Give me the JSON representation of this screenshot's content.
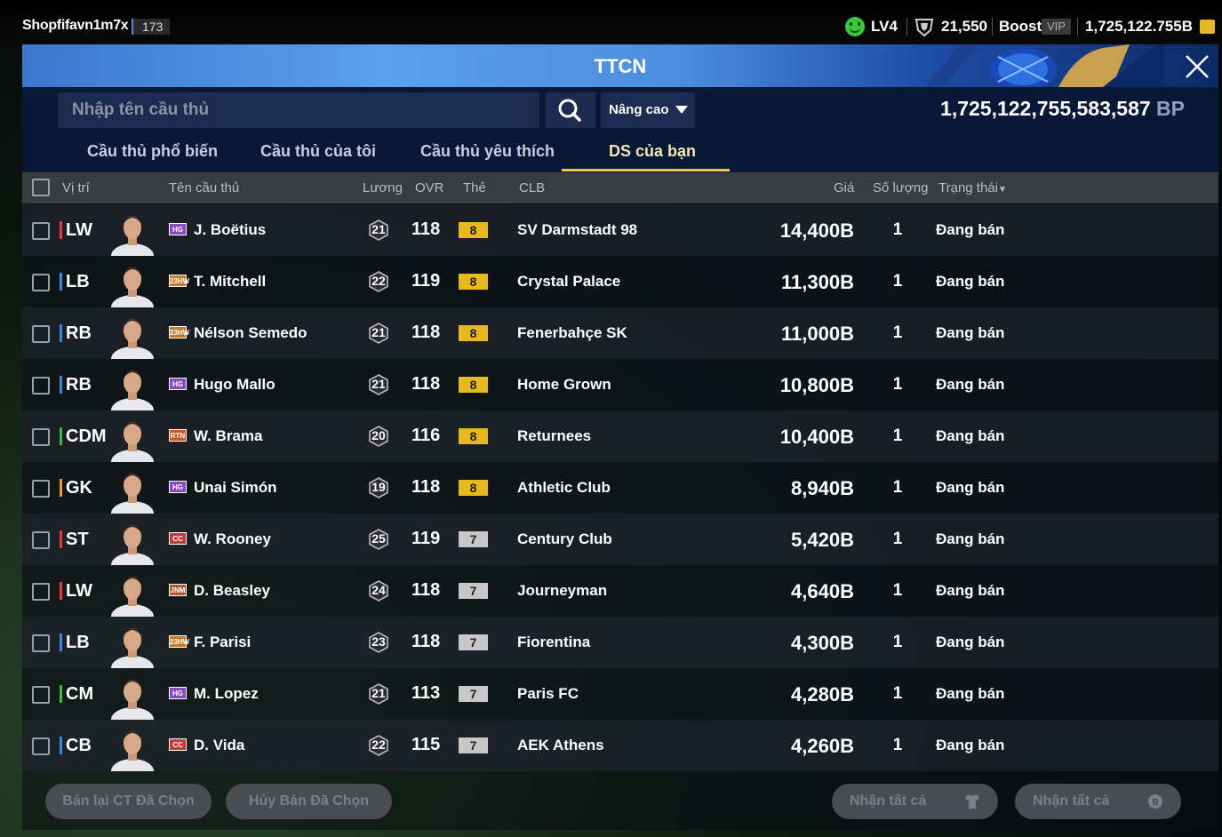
{
  "header": {
    "username": "Shopfifavn1m7x",
    "user_badge": "173",
    "level": "LV4",
    "trophies": "21,550",
    "boost": "Boost",
    "vip": "VIP",
    "coins": "1,725,122.755B"
  },
  "window": {
    "title": "TTCN",
    "search_placeholder": "Nhập tên cầu thủ",
    "advanced_label": "Nâng cao",
    "bp_amount": "1,725,122,755,583,587",
    "bp_unit": "BP"
  },
  "tabs": [
    "Cầu thủ phổ biến",
    "Cầu thủ của tôi",
    "Cầu thủ yêu thích",
    "DS của bạn"
  ],
  "columns": {
    "position": "Vị trí",
    "player": "Tên cầu thủ",
    "wage": "Lương",
    "ovr": "OVR",
    "grade": "Thẻ",
    "club": "CLB",
    "price": "Giá",
    "quantity": "Số lượng",
    "status": "Trạng thái"
  },
  "colors": {
    "forward": "#e8383c",
    "defender": "#3a8ad8",
    "midfielder": "#3ab84a",
    "goalkeeper": "#e8a020",
    "grade8": "#e8b820",
    "grade7": "#c8c8c8"
  },
  "players": [
    {
      "pos": "LW",
      "group": "forward",
      "season": "HG",
      "season_color": "#8a4ac8",
      "name": "J. Boëtius",
      "wage": "21",
      "ovr": "118",
      "grade": "8",
      "club": "SV Darmstadt 98",
      "price": "14,400B",
      "qty": "1",
      "status": "Đang bán"
    },
    {
      "pos": "LB",
      "group": "defender",
      "season": "23HW",
      "season_color": "#c87a28",
      "name": "T. Mitchell",
      "wage": "22",
      "ovr": "119",
      "grade": "8",
      "club": "Crystal Palace",
      "price": "11,300B",
      "qty": "1",
      "status": "Đang bán"
    },
    {
      "pos": "RB",
      "group": "defender",
      "season": "23HW",
      "season_color": "#c87a28",
      "name": "Nélson Semedo",
      "wage": "21",
      "ovr": "118",
      "grade": "8",
      "club": "Fenerbahçe SK",
      "price": "11,000B",
      "qty": "1",
      "status": "Đang bán"
    },
    {
      "pos": "RB",
      "group": "defender",
      "season": "HG",
      "season_color": "#8a4ac8",
      "name": "Hugo Mallo",
      "wage": "21",
      "ovr": "118",
      "grade": "8",
      "club": "Home Grown",
      "price": "10,800B",
      "qty": "1",
      "status": "Đang bán"
    },
    {
      "pos": "CDM",
      "group": "midfielder",
      "season": "RTN",
      "season_color": "#c85a28",
      "name": "W. Brama",
      "wage": "20",
      "ovr": "116",
      "grade": "8",
      "club": "Returnees",
      "price": "10,400B",
      "qty": "1",
      "status": "Đang bán"
    },
    {
      "pos": "GK",
      "group": "goalkeeper",
      "season": "HG",
      "season_color": "#8a4ac8",
      "name": "Unai Simón",
      "wage": "19",
      "ovr": "118",
      "grade": "8",
      "club": "Athletic Club",
      "price": "8,940B",
      "qty": "1",
      "status": "Đang bán"
    },
    {
      "pos": "ST",
      "group": "forward",
      "season": "CC",
      "season_color": "#c83a3a",
      "name": "W. Rooney",
      "wage": "25",
      "ovr": "119",
      "grade": "7",
      "club": "Century Club",
      "price": "5,420B",
      "qty": "1",
      "status": "Đang bán"
    },
    {
      "pos": "LW",
      "group": "forward",
      "season": "JNM",
      "season_color": "#b85a28",
      "name": "D. Beasley",
      "wage": "24",
      "ovr": "118",
      "grade": "7",
      "club": "Journeyman",
      "price": "4,640B",
      "qty": "1",
      "status": "Đang bán"
    },
    {
      "pos": "LB",
      "group": "defender",
      "season": "23HW",
      "season_color": "#c87a28",
      "name": "F. Parisi",
      "wage": "23",
      "ovr": "118",
      "grade": "7",
      "club": "Fiorentina",
      "price": "4,300B",
      "qty": "1",
      "status": "Đang bán"
    },
    {
      "pos": "CM",
      "group": "midfielder",
      "season": "HG",
      "season_color": "#8a4ac8",
      "name": "M. Lopez",
      "wage": "21",
      "ovr": "113",
      "grade": "7",
      "club": "Paris FC",
      "price": "4,280B",
      "qty": "1",
      "status": "Đang bán"
    },
    {
      "pos": "CB",
      "group": "defender",
      "season": "CC",
      "season_color": "#c83a3a",
      "name": "D. Vida",
      "wage": "22",
      "ovr": "115",
      "grade": "7",
      "club": "AEK Athens",
      "price": "4,260B",
      "qty": "1",
      "status": "Đang bán"
    }
  ],
  "footer": {
    "resell_selected": "Bán lại CT Đã Chọn",
    "cancel_selected": "Hủy Bán Đã Chọn",
    "claim_all_1": "Nhận tất cả",
    "claim_all_2": "Nhận tất cả"
  }
}
